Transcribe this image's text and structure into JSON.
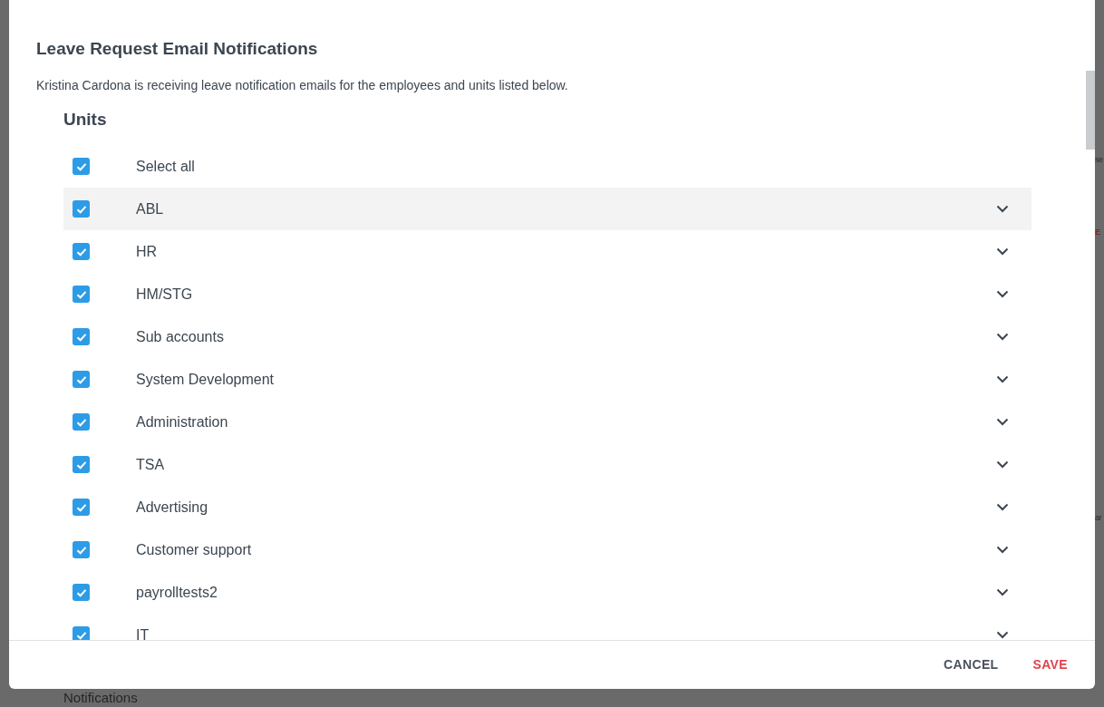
{
  "background": {
    "texts": [
      {
        "text": "se",
        "kind": "plain"
      },
      {
        "text": "E",
        "kind": "alert"
      },
      {
        "text": "ar",
        "kind": "plain"
      }
    ],
    "section_title": "Notifications"
  },
  "dialog": {
    "title": "Leave Request Email Notifications",
    "description": "Kristina Cardona is receiving leave notification emails for the employees and units listed below.",
    "section": "Units",
    "select_all": {
      "label": "Select all",
      "checked": true
    },
    "units": [
      {
        "label": "ABL",
        "checked": true,
        "highlighted": true
      },
      {
        "label": "HR",
        "checked": true,
        "highlighted": false
      },
      {
        "label": "HM/STG",
        "checked": true,
        "highlighted": false
      },
      {
        "label": "Sub accounts",
        "checked": true,
        "highlighted": false
      },
      {
        "label": "System Development",
        "checked": true,
        "highlighted": false
      },
      {
        "label": "Administration",
        "checked": true,
        "highlighted": false
      },
      {
        "label": "TSA",
        "checked": true,
        "highlighted": false
      },
      {
        "label": "Advertising",
        "checked": true,
        "highlighted": false
      },
      {
        "label": "Customer support",
        "checked": true,
        "highlighted": false
      },
      {
        "label": "payrolltests2",
        "checked": true,
        "highlighted": false
      },
      {
        "label": "IT",
        "checked": true,
        "highlighted": false
      }
    ],
    "buttons": [
      {
        "label": "CANCEL",
        "kind": "secondary"
      },
      {
        "label": "SAVE",
        "kind": "primary"
      }
    ]
  }
}
